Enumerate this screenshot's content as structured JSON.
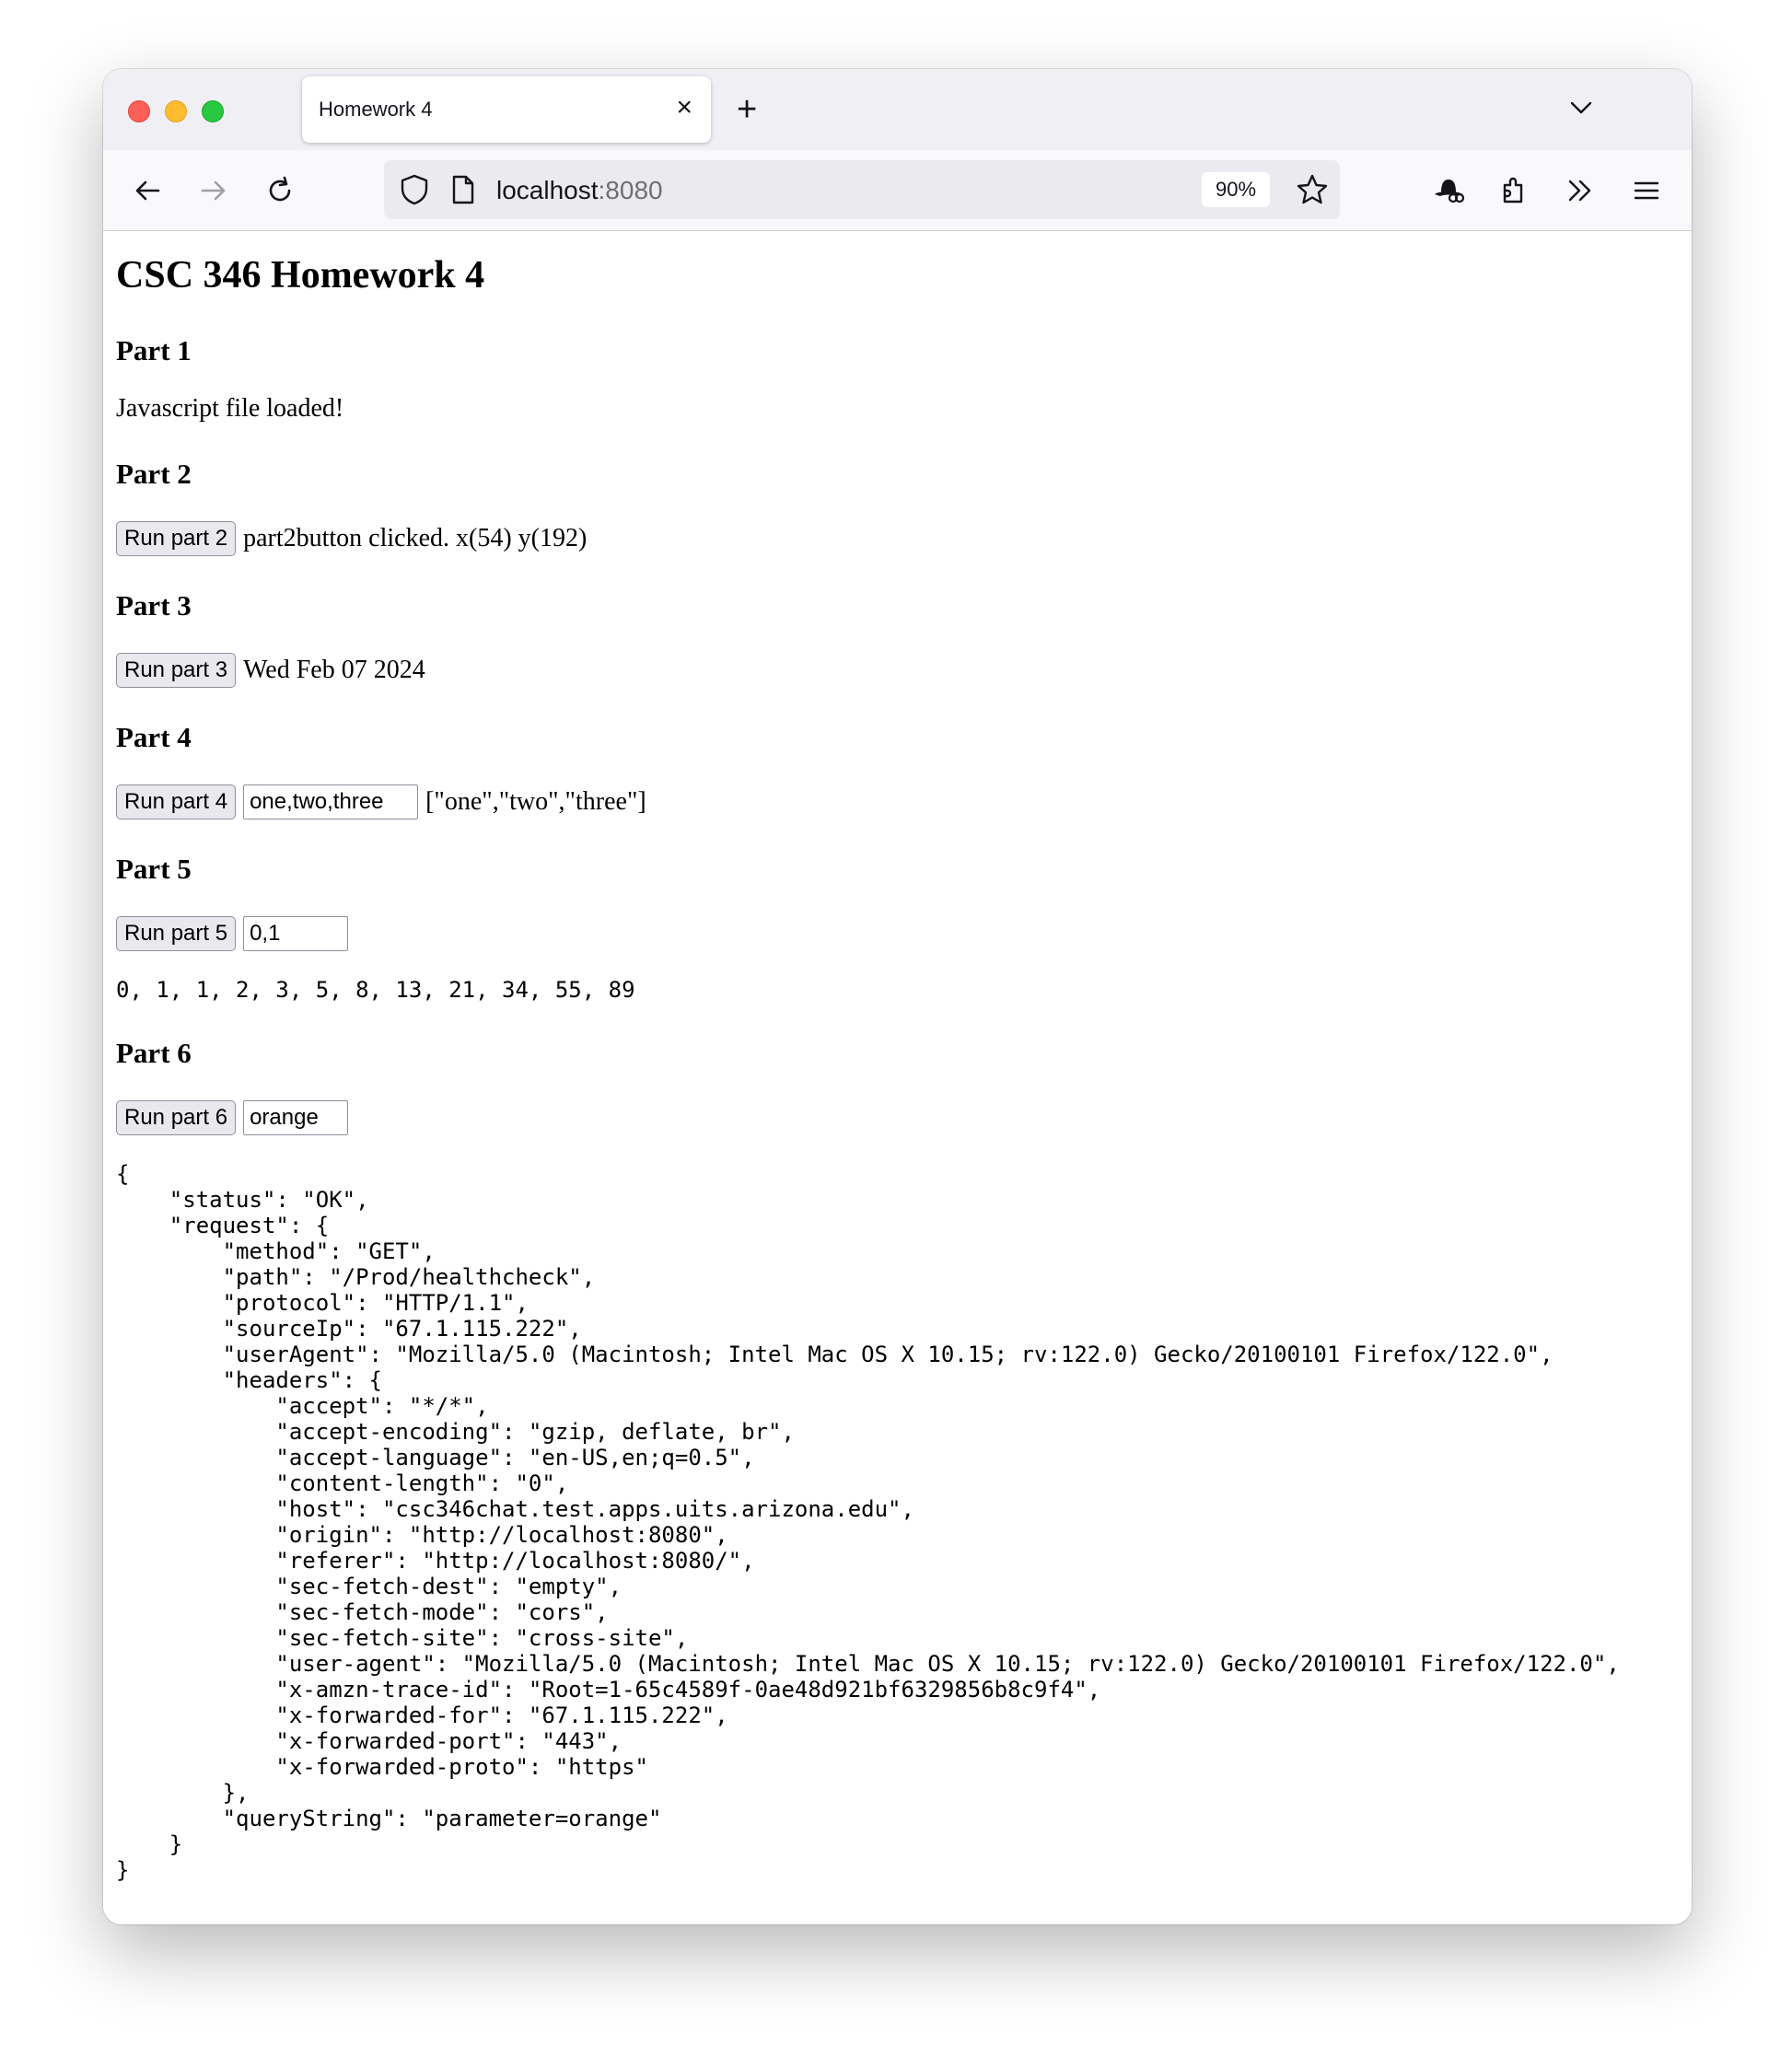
{
  "browser": {
    "tab_title": "Homework 4",
    "url_host": "localhost",
    "url_port": ":8080",
    "zoom": "90%"
  },
  "page": {
    "title": "CSC 346 Homework 4",
    "part1": {
      "heading": "Part 1",
      "output": "Javascript file loaded!"
    },
    "part2": {
      "heading": "Part 2",
      "button": "Run part 2",
      "output": "part2button clicked. x(54) y(192)"
    },
    "part3": {
      "heading": "Part 3",
      "button": "Run part 3",
      "output": "Wed Feb 07 2024"
    },
    "part4": {
      "heading": "Part 4",
      "button": "Run part 4",
      "input_value": "one,two,three",
      "output": "[\"one\",\"two\",\"three\"]"
    },
    "part5": {
      "heading": "Part 5",
      "button": "Run part 5",
      "input_value": "0,1",
      "output": "0, 1, 1, 2, 3, 5, 8, 13, 21, 34, 55, 89"
    },
    "part6": {
      "heading": "Part 6",
      "button": "Run part 6",
      "input_value": "orange",
      "output": "{\n    \"status\": \"OK\",\n    \"request\": {\n        \"method\": \"GET\",\n        \"path\": \"/Prod/healthcheck\",\n        \"protocol\": \"HTTP/1.1\",\n        \"sourceIp\": \"67.1.115.222\",\n        \"userAgent\": \"Mozilla/5.0 (Macintosh; Intel Mac OS X 10.15; rv:122.0) Gecko/20100101 Firefox/122.0\",\n        \"headers\": {\n            \"accept\": \"*/*\",\n            \"accept-encoding\": \"gzip, deflate, br\",\n            \"accept-language\": \"en-US,en;q=0.5\",\n            \"content-length\": \"0\",\n            \"host\": \"csc346chat.test.apps.uits.arizona.edu\",\n            \"origin\": \"http://localhost:8080\",\n            \"referer\": \"http://localhost:8080/\",\n            \"sec-fetch-dest\": \"empty\",\n            \"sec-fetch-mode\": \"cors\",\n            \"sec-fetch-site\": \"cross-site\",\n            \"user-agent\": \"Mozilla/5.0 (Macintosh; Intel Mac OS X 10.15; rv:122.0) Gecko/20100101 Firefox/122.0\",\n            \"x-amzn-trace-id\": \"Root=1-65c4589f-0ae48d921bf6329856b8c9f4\",\n            \"x-forwarded-for\": \"67.1.115.222\",\n            \"x-forwarded-port\": \"443\",\n            \"x-forwarded-proto\": \"https\"\n        },\n        \"queryString\": \"parameter=orange\"\n    }\n}"
    }
  }
}
